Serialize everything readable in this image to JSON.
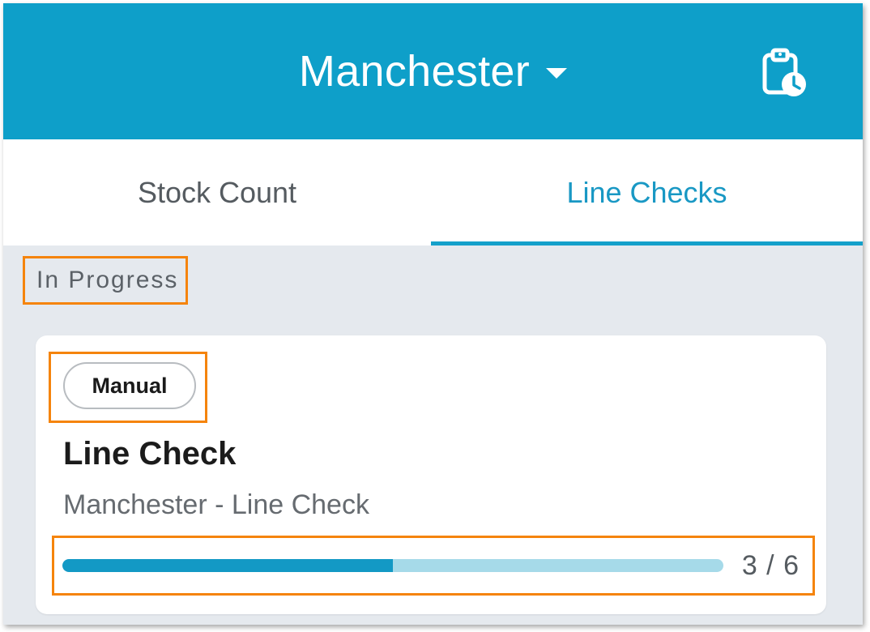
{
  "header": {
    "location": "Manchester",
    "caret_icon": "caret-down-icon",
    "history_icon": "clipboard-clock-icon",
    "background_color": "#0e9fc9"
  },
  "tabs": [
    {
      "label": "Stock Count",
      "active": false
    },
    {
      "label": "Line Checks",
      "active": true
    }
  ],
  "accent_color": "#14a0ca",
  "section": {
    "heading": "In Progress"
  },
  "card": {
    "badge": "Manual",
    "title": "Line Check",
    "subtitle": "Manchester - Line Check",
    "progress": {
      "completed": 3,
      "total": 6,
      "label": "3 / 6"
    }
  }
}
